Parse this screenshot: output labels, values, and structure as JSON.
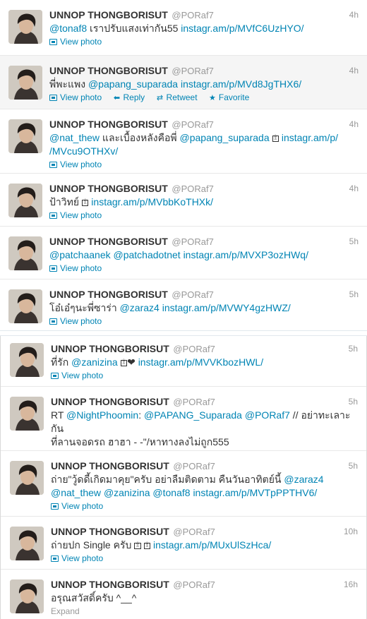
{
  "user": {
    "fullname": "UNNOP THONGBORISUT",
    "username": "@PORaf7"
  },
  "actions": {
    "view_photo": "View photo",
    "reply": "Reply",
    "retweet": "Retweet",
    "favorite": "Favorite",
    "expand": "Expand"
  },
  "glyph_label": "ꂂ",
  "tweets": [
    {
      "time": "4h",
      "parts": [
        [
          "@tonaf8",
          "m"
        ],
        [
          " เราปรับแสงเท่ากัน55 ",
          "t"
        ],
        [
          "instagr.am/p/MVfC6UzHYO/",
          "l"
        ]
      ]
    },
    {
      "time": "4h",
      "parts": [
        [
          "พี่พะแพง ",
          "t"
        ],
        [
          "@papang_suparada",
          "m"
        ],
        [
          " ",
          "t"
        ],
        [
          "instagr.am/p/MVd8JgTHX6/",
          "l"
        ]
      ]
    },
    {
      "time": "4h",
      "line1": [
        [
          "@nat_thew",
          "m"
        ],
        [
          " และเบื้องหลังคือพี่ ",
          "t"
        ],
        [
          "@papang_suparada",
          "m"
        ]
      ],
      "line1_url": "instagr.am/p/",
      "line2_url": "/MVcu9OTHXv/"
    },
    {
      "time": "4h",
      "pre": "ป้าวิทย์",
      "url": "instagr.am/p/MVbbKoTHXk/"
    },
    {
      "time": "5h",
      "parts": [
        [
          "@patchaanek",
          "m"
        ],
        [
          " ",
          "t"
        ],
        [
          "@patchadotnet",
          "m"
        ],
        [
          " ",
          "t"
        ],
        [
          "instagr.am/p/MVXP3ozHWq/",
          "l"
        ]
      ]
    },
    {
      "time": "5h",
      "parts": [
        [
          "โอ๋เอ๋ๆนะพี่ซาร่า ",
          "t"
        ],
        [
          "@zaraz4",
          "m"
        ],
        [
          " ",
          "t"
        ],
        [
          "instagr.am/p/MVWY4gzHWZ/",
          "l"
        ]
      ]
    },
    {
      "time": "5h",
      "pre": "ที่รัก ",
      "mention": "@zanizina",
      "heart": "❤",
      "url": "instagr.am/p/MVVKbozHWL/"
    },
    {
      "time": "5h",
      "line1": [
        [
          "RT ",
          "t"
        ],
        [
          "@NightPhoomin",
          "m"
        ],
        [
          ": ",
          "t"
        ],
        [
          "@PAPANG_Suparada",
          "m"
        ],
        [
          " ",
          "t"
        ],
        [
          "@PORaf7",
          "m"
        ],
        [
          " // อย่าทะเลาะกัน",
          "t"
        ]
      ],
      "line2": "ที่ลานจอดรถ ฮาฮา - -\"/หาทางลงไม่ถูก555"
    },
    {
      "time": "5h",
      "line1": [
        [
          "ถ่าย\"วู้ดดี้เกิดมาคุย\"ครับ อย่าลืมติดตาม คืนวันอาทิตย์นี้ ",
          "t"
        ],
        [
          "@zaraz4",
          "m"
        ]
      ],
      "line2": [
        [
          "@nat_thew",
          "m"
        ],
        [
          " ",
          "t"
        ],
        [
          "@zanizina",
          "m"
        ],
        [
          " ",
          "t"
        ],
        [
          "@tonaf8",
          "m"
        ],
        [
          " ",
          "t"
        ],
        [
          "instagr.am/p/MVTpPPTHV6/",
          "l"
        ]
      ]
    },
    {
      "time": "10h",
      "pre": "ถ่ายปก Single ครับ",
      "url": "instagr.am/p/MUxUlSzHca/"
    },
    {
      "time": "16h",
      "text": "อรุณสวัสดิ์ครับ ^__^"
    }
  ],
  "colors": {
    "link": "#0084b4",
    "meta": "#999999",
    "text": "#333333",
    "hover_bg": "#f5f5f5"
  }
}
